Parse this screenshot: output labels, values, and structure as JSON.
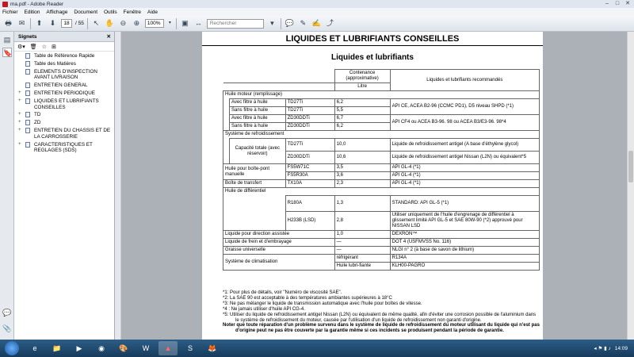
{
  "window": {
    "title": "ma.pdf - Adobe Reader"
  },
  "menu": [
    "Fichier",
    "Edition",
    "Affichage",
    "Document",
    "Outils",
    "Fenêtre",
    "Aide"
  ],
  "toolbar": {
    "page_current": "18",
    "page_total": "/ 55",
    "zoom": "100%",
    "search_placeholder": "Rechercher"
  },
  "bookmarks": {
    "title": "Signets",
    "items": [
      {
        "label": "Table de Référence Rapide",
        "exp": ""
      },
      {
        "label": "Table des Matières",
        "exp": ""
      },
      {
        "label": "ELEMENTS D'INSPECTION AVANT LIVRAISON",
        "exp": ""
      },
      {
        "label": "ENTRETIEN GENERAL",
        "exp": ""
      },
      {
        "label": "ENTRETIEN PERIODIQUE",
        "exp": "+"
      },
      {
        "label": "LIQUIDES ET LUBRIFIANTS CONSEILLES",
        "exp": "+"
      },
      {
        "label": "TD",
        "exp": "+"
      },
      {
        "label": "ZD",
        "exp": "+"
      },
      {
        "label": "ENTRETIEN DU CHASSIS ET DE LA CARROSSERIE",
        "exp": "+"
      },
      {
        "label": "CARACTERISTIQUES ET REGLAGES (SDS)",
        "exp": "+"
      }
    ]
  },
  "doc": {
    "title": "LIQUIDES ET LUBRIFIANTS CONSEILLES",
    "subtitle": "Liquides et lubrifiants",
    "th_capacity": "Contenance (approximative)",
    "th_liters": "Litre",
    "th_recommended": "Liquides et lubrifiants recommandés",
    "rows": {
      "engine_oil": "Huile moteur (remplissage)",
      "with_filter": "Avec filtre à huile",
      "without_filter": "Sans filtre à huile",
      "td27ti": "TD27Ti",
      "zd30ddti": "ZD30DDTi",
      "v1": "6,2",
      "v2": "5,5",
      "v3": "6,7",
      "v4": "6,2",
      "rec_td": "API CE, ACEA B2-96 (CCMC PD1), D5 niveau SHPD (*1)",
      "rec_zd": "API CF4 ou ACEA B3-96. 98 ou ACEA B3/E3-96. 98*4",
      "cooling": "Système de refroidissement",
      "capacity_total": "Capacité totale (avec réservoir)",
      "cool_td_val": "10,0",
      "cool_zd_val": "10,6",
      "cool_td_rec": "Liquide de refroidissement antigel (A base d'éthylène glycol)",
      "cool_zd_rec": "Liquide de refroidissement antigel Nissan (L2N) ou équivalent*5",
      "gearbox": "Huile pour boîte-pont manuelle",
      "fs5w71c": "FS5W71C",
      "fs5w71c_val": "3,5",
      "fs5r30a": "FS5R30A",
      "fs5r30a_val": "3,6",
      "api_gl4": "API GL-4 (*1)",
      "transfer": "Boîte de transfert",
      "tx10a": "TX10A",
      "tx10a_val": "2,3",
      "diff": "Huile de différentiel",
      "r180a": "R180A",
      "r180a_val": "1,3",
      "r180a_rec": "STANDARD: API GL-5 (*1)",
      "h233b": "H233B (LSD)",
      "h233b_val": "2,8",
      "h233b_rec": "Utiliser uniquement de l'huile d'engrenage de différentiel à glissement limité API GL-5 et SAE 80W-90 (*2) approuvé pour NISSAN LSD",
      "power_steering": "Liquide pour direction assistée",
      "ps_val": "1,0",
      "ps_rec": "DEXRON™",
      "brake": "Liquide de frein et d'embrayage",
      "dash": "—",
      "brake_rec": "DOT 4 (USFMVSS No. 116)",
      "grease": "Graisse universelle",
      "grease_rec": "NLGI n° 2 (à base de savon de lithium)",
      "ac": "Système de climatisation",
      "refrigerant": "réfrigérant",
      "lube_oil": "Huile lubri-fiante",
      "ac_rec1": "R134A",
      "ac_rec2": "KLH00-PAGRO"
    },
    "notes": [
      "*1: Pour plus de détails, voir \"Numéro de viscosité SAE\".",
      "*2: La SAE 90 est acceptable à des températures ambiantes supérieures à 18°C",
      "*3: Ne pas mélanger le liquide de transmission automatique avec l'huile pour boîtes de vitesse.",
      "*4 : Ne jamais utiliser d'huile API CG-4.",
      "*5: Utiliser du liquide de refroidissement antigel Nissan (L2N) ou équivalent de même qualité, afin d'éviter une corrosion possible de l'aluminium dans le système de refroidissement du moteur, causée par l'utilisation d'un liquide de refroidissement non garanti d'origine."
    ],
    "note_bold": "Noter que toute réparation d'un problème survenu dans le système de liquide de refroidissement du moteur utilisant du liquide qui n'est pas d'origine peut ne pas être couverte par la garantie même si ces incidents se produisent pendant la période de garantie."
  },
  "taskbar": {
    "clock": "14:09"
  }
}
